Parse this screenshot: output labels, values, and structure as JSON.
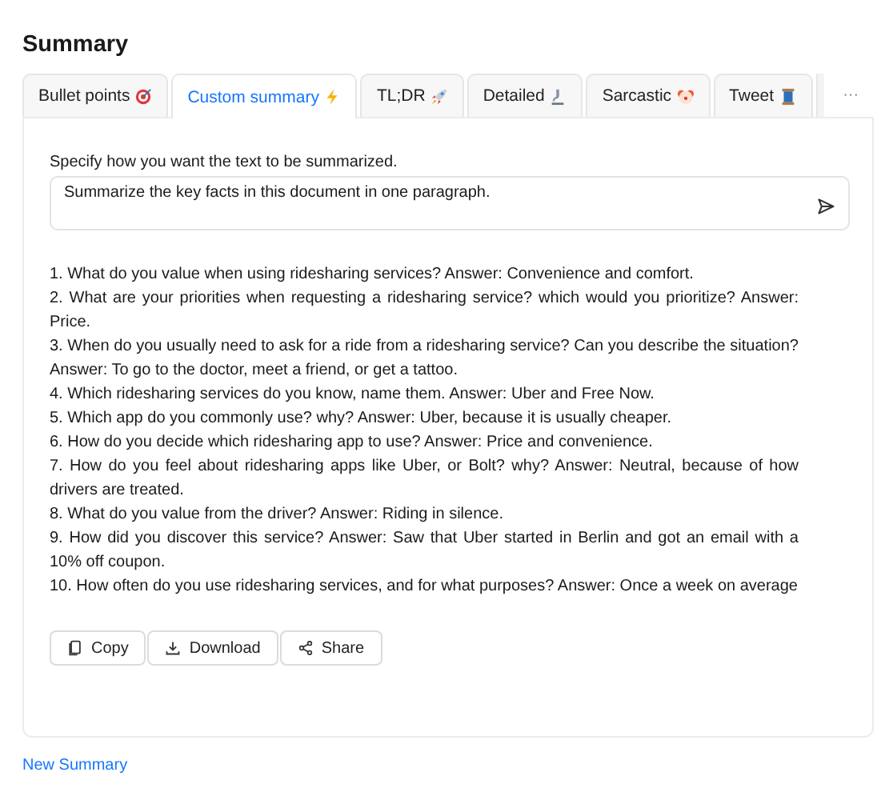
{
  "title": "Summary",
  "tabs": [
    {
      "label": "Bullet points",
      "selected": false
    },
    {
      "label": "Custom summary",
      "selected": true
    },
    {
      "label": "TL;DR",
      "selected": false
    },
    {
      "label": "Detailed",
      "selected": false
    },
    {
      "label": "Sarcastic",
      "selected": false
    },
    {
      "label": "Tweet",
      "selected": false
    }
  ],
  "more_button": "···",
  "prompt": {
    "label": "Specify how you want the text to be summarized.",
    "value": "Summarize the key facts in this document in one paragraph."
  },
  "summary_items": [
    "1. What do you value when using ridesharing services? Answer: Convenience and comfort.",
    "2. What are your priorities when requesting a ridesharing service? which would you prioritize? Answer: Price.",
    "3. When do you usually need to ask for a ride from a ridesharing service? Can you describe the situation? Answer: To go to the doctor, meet a friend, or get a tattoo.",
    "4. Which ridesharing services do you know, name them. Answer: Uber and Free Now.",
    "5. Which app do you commonly use? why? Answer: Uber, because it is usually cheaper.",
    "6. How do you decide which ridesharing app to use? Answer: Price and convenience.",
    "7. How do you feel about ridesharing apps like Uber, or Bolt? why? Answer: Neutral, because of how drivers are treated.",
    "8. What do you value from the driver? Answer: Riding in silence.",
    "9. How did you discover this service? Answer: Saw that Uber started in Berlin and got an email with a 10% off coupon.",
    "10. How often do you use ridesharing services, and for what purposes? Answer: Once a week on average"
  ],
  "actions": [
    {
      "label": "Copy",
      "kind": "copy"
    },
    {
      "label": "Download",
      "kind": "download"
    },
    {
      "label": "Share",
      "kind": "share"
    }
  ],
  "new_summary_link": "New Summary"
}
